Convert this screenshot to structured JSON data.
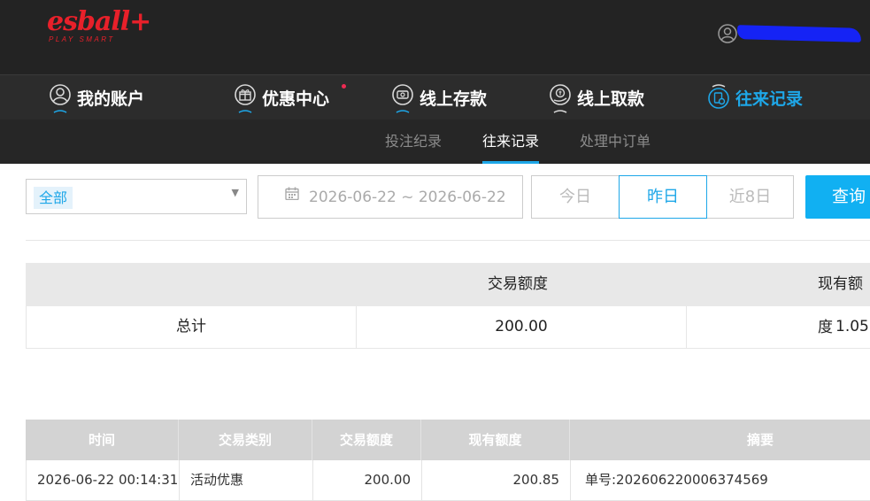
{
  "header": {
    "logo_text": "esball+",
    "logo_tagline": "PLAY SMART",
    "username_redacted": true,
    "colors": {
      "background": "#232323",
      "logo": "#e8202a",
      "redaction": "#1523f5"
    }
  },
  "main_nav": {
    "items": [
      {
        "label": "我的账户",
        "icon": "user-icon",
        "active": false
      },
      {
        "label": "优惠中心",
        "icon": "gift-icon",
        "active": false,
        "has_badge": true
      },
      {
        "label": "线上存款",
        "icon": "deposit-icon",
        "active": false
      },
      {
        "label": "线上取款",
        "icon": "withdraw-icon",
        "active": false
      },
      {
        "label": "往来记录",
        "icon": "records-icon",
        "active": true
      }
    ],
    "colors": {
      "active": "#1ea7e8",
      "badge": "#ee2a52"
    }
  },
  "sub_nav": {
    "items": [
      {
        "label": "投注纪录",
        "active": false
      },
      {
        "label": "往来记录",
        "active": true
      },
      {
        "label": "处理中订单",
        "active": false
      }
    ]
  },
  "filters": {
    "type_select": {
      "value": "全部",
      "icon": "caret-down-icon"
    },
    "date_range": {
      "value": "2026-06-22 ~ 2026-06-22",
      "icon": "calendar-icon"
    },
    "quick_ranges": [
      {
        "label": "今日",
        "active": false
      },
      {
        "label": "昨日",
        "active": true
      },
      {
        "label": "近8日",
        "active": false
      }
    ],
    "query_button": "查询"
  },
  "summary": {
    "headers": {
      "amount": "交易额度",
      "balance": "现有额度"
    },
    "row": {
      "label": "总计",
      "amount": "200.00",
      "balance": "1.05"
    }
  },
  "transactions": {
    "headers": [
      "时间",
      "交易类别",
      "交易额度",
      "现有额度",
      "摘要"
    ],
    "rows": [
      [
        "2026-06-22 00:14:31",
        "活动优惠",
        "200.00",
        "200.85",
        "单号:202606220006374569"
      ]
    ]
  }
}
